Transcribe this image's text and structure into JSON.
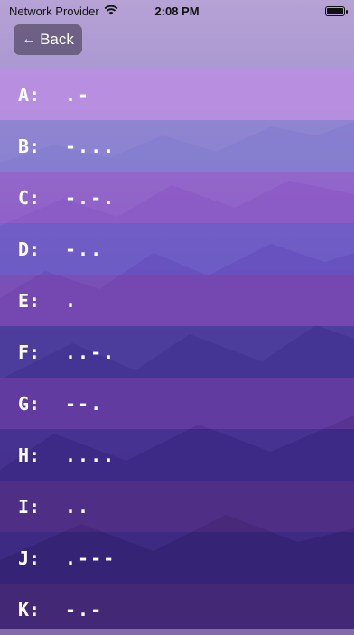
{
  "status_bar": {
    "carrier": "Network Provider",
    "time": "2:08 PM",
    "wifi_icon": "wifi-icon",
    "battery_icon": "battery-icon"
  },
  "nav": {
    "back_icon": "left-arrow-icon",
    "back_label": "Back"
  },
  "morse": [
    {
      "letter": "A:",
      "code": ".-"
    },
    {
      "letter": "B:",
      "code": "-..."
    },
    {
      "letter": "C:",
      "code": "-.-."
    },
    {
      "letter": "D:",
      "code": "-.."
    },
    {
      "letter": "E:",
      "code": "."
    },
    {
      "letter": "F:",
      "code": "..-."
    },
    {
      "letter": "G:",
      "code": "--."
    },
    {
      "letter": "H:",
      "code": "...."
    },
    {
      "letter": "I:",
      "code": ".."
    },
    {
      "letter": "J:",
      "code": ".---"
    },
    {
      "letter": "K:",
      "code": "-.-"
    }
  ],
  "colors": {
    "background_top": "#b6a2d4",
    "background_bottom": "#2f205f",
    "row_text": "#ffffff",
    "back_button_bg": "#5a506e"
  }
}
